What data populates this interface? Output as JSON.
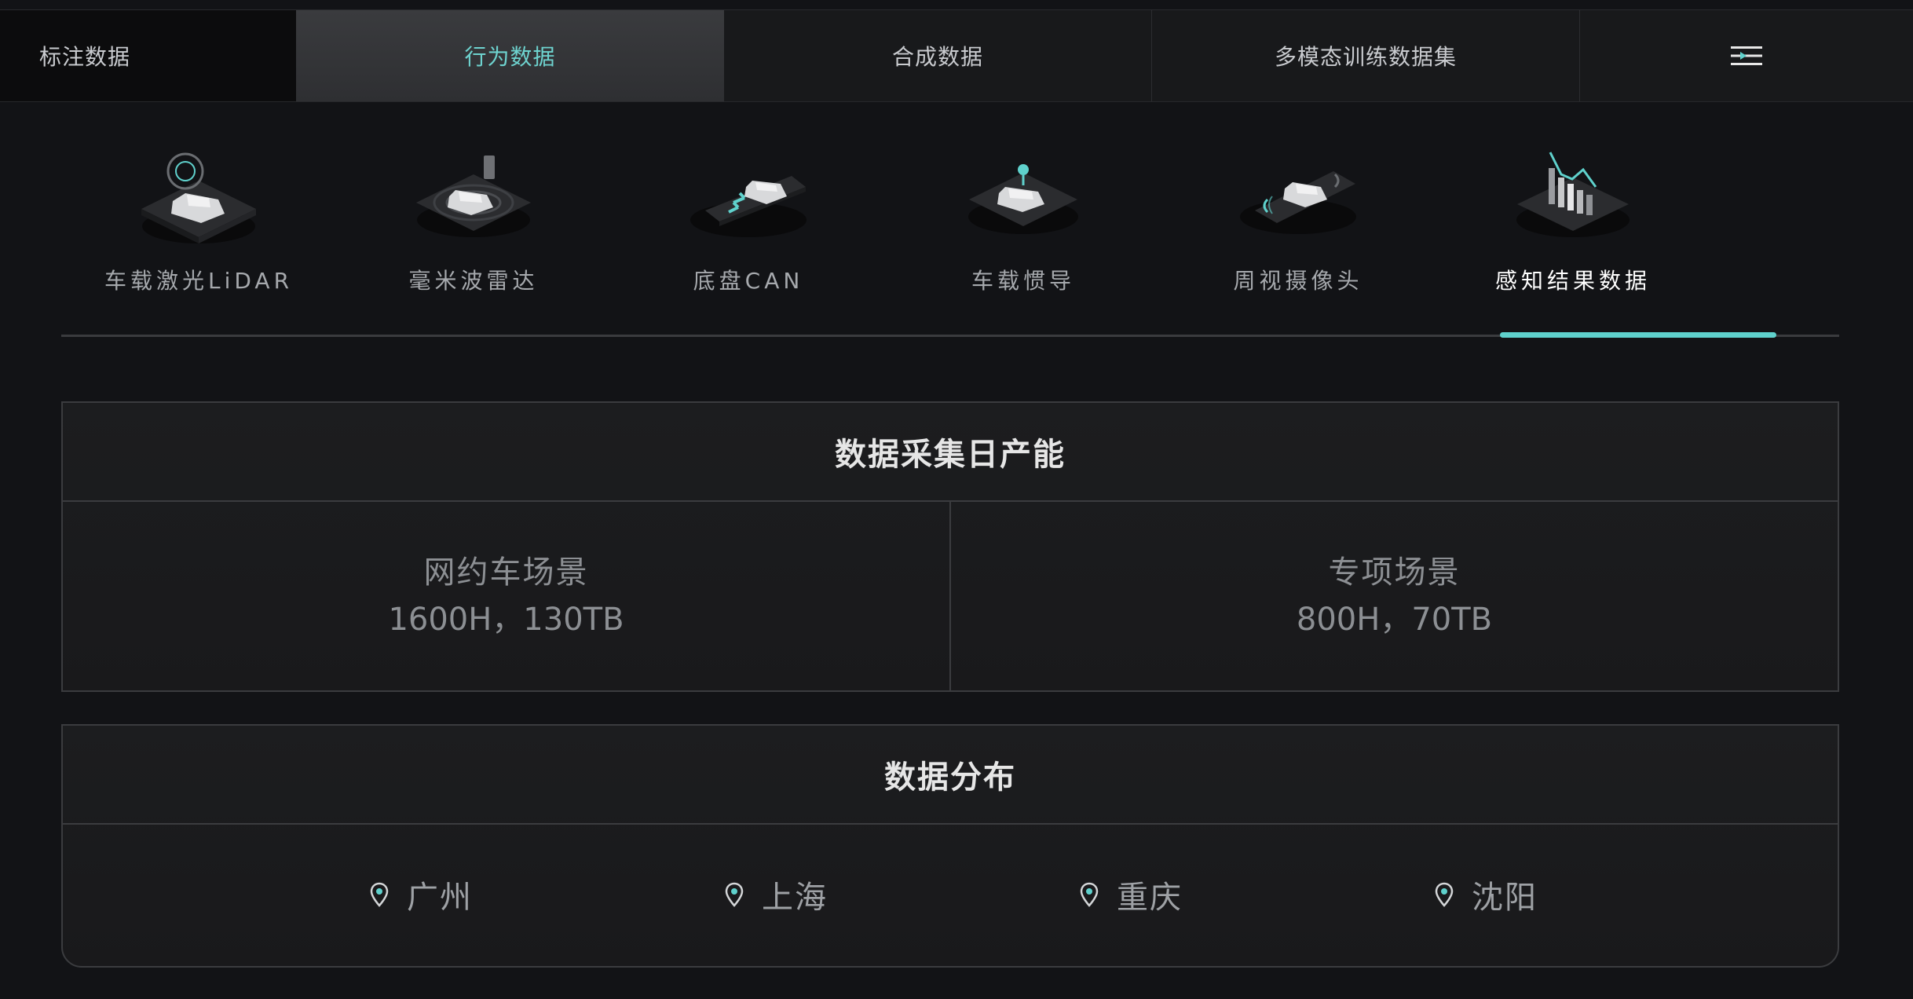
{
  "top_tabs": [
    {
      "label": "标注数据",
      "active": false
    },
    {
      "label": "行为数据",
      "active": true
    },
    {
      "label": "合成数据",
      "active": false
    },
    {
      "label": "多模态训练数据集",
      "active": false
    }
  ],
  "menu_icon": "menu-icon",
  "sensors": [
    {
      "label": "车载激光LiDAR",
      "icon": "lidar-car-icon",
      "active": false
    },
    {
      "label": "毫米波雷达",
      "icon": "radar-car-icon",
      "active": false
    },
    {
      "label": "底盘CAN",
      "icon": "can-car-icon",
      "active": false
    },
    {
      "label": "车载惯导",
      "icon": "imu-car-icon",
      "active": false
    },
    {
      "label": "周视摄像头",
      "icon": "camera-car-icon",
      "active": false
    },
    {
      "label": "感知结果数据",
      "icon": "perception-chart-icon",
      "active": true
    }
  ],
  "capacity": {
    "title": "数据采集日产能",
    "items": [
      {
        "name": "网约车场景",
        "value": "1600H，130TB"
      },
      {
        "name": "专项场景",
        "value": "800H，70TB"
      }
    ]
  },
  "distribution": {
    "title": "数据分布",
    "cities": [
      "广州",
      "上海",
      "重庆",
      "沈阳"
    ]
  },
  "colors": {
    "accent": "#5fd1cc",
    "background": "#121316",
    "panel_border": "#3b3c3f"
  }
}
